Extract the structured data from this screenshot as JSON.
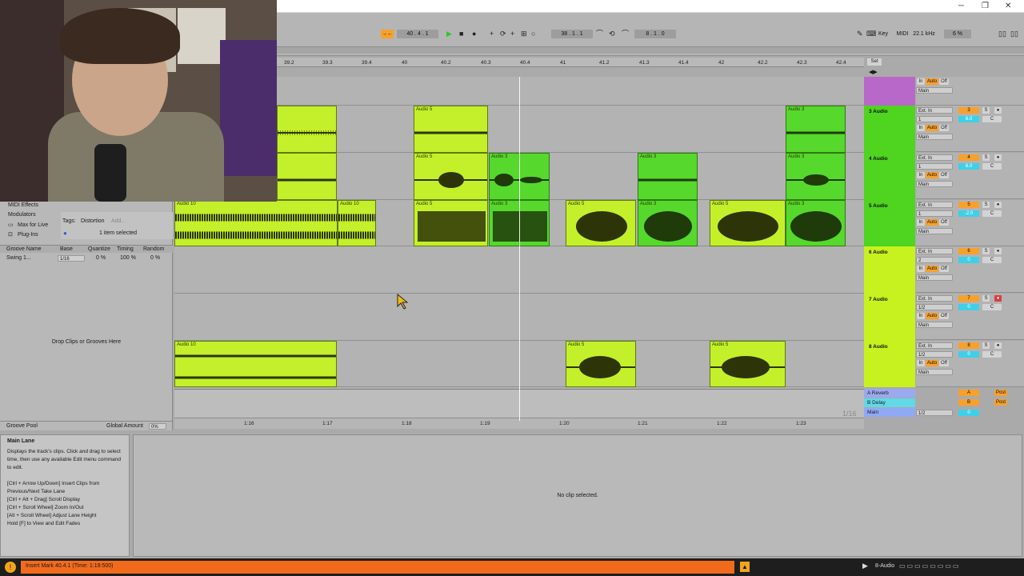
{
  "window": {
    "minimize": "─",
    "restore": "❐",
    "close": "✕"
  },
  "transport": {
    "tempo_nudge": "→←",
    "position": "40 . 4 . 1",
    "loop_start": "38 . 1 . 1",
    "loop_length": "8 . 1 . 0",
    "midi_label": "MIDI",
    "key_label": "Key",
    "sample_rate": "22.1 kHz",
    "cpu": "6 %"
  },
  "ruler": [
    "39.2",
    "39.3",
    "39.4",
    "40",
    "40.2",
    "40.3",
    "40.4",
    "41",
    "41.2",
    "41.3",
    "41.4",
    "42",
    "42.2",
    "42.3",
    "42.4"
  ],
  "ruler_set": "Set",
  "timebar": [
    "1:16",
    "1:17",
    "1:18",
    "1:19",
    "1:20",
    "1:21",
    "1:22",
    "1:23"
  ],
  "grid_label": "1/16",
  "tracks": [
    {
      "name": "3 Audio",
      "color": "#4fd41f",
      "input": "Ext. In",
      "channel": "1",
      "monitor": [
        "In",
        "Auto",
        "Off"
      ],
      "out": "Main",
      "num": "3",
      "vol": "6.0",
      "pan": "C"
    },
    {
      "name": "4 Audio",
      "color": "#4fd41f",
      "input": "Ext. In",
      "channel": "1",
      "monitor": [
        "In",
        "Auto",
        "Off"
      ],
      "out": "Main",
      "num": "4",
      "vol": "6.0",
      "pan": "C"
    },
    {
      "name": "5 Audio",
      "color": "#4fd41f",
      "input": "Ext. In",
      "channel": "1",
      "monitor": [
        "In",
        "Auto",
        "Off"
      ],
      "out": "Main",
      "num": "5",
      "vol": "-2.0",
      "pan": "C"
    },
    {
      "name": "6 Audio",
      "color": "#c7f21f",
      "input": "Ext. In",
      "channel": "2",
      "monitor": [
        "In",
        "Auto",
        "Off"
      ],
      "out": "Main",
      "num": "6",
      "vol": "0",
      "pan": "C"
    },
    {
      "name": "7 Audio",
      "color": "#c7f21f",
      "input": "Ext. In",
      "channel": "1/2",
      "monitor": [
        "In",
        "Auto",
        "Off"
      ],
      "out": "Main",
      "num": "7",
      "vol": "0",
      "pan": "C"
    },
    {
      "name": "8 Audio",
      "color": "#c7f21f",
      "input": "Ext. In",
      "channel": "1/2",
      "monitor": [
        "In",
        "Auto",
        "Off"
      ],
      "out": "Main",
      "num": "8",
      "vol": "0",
      "pan": "C"
    }
  ],
  "top_track": {
    "monitor": [
      "In",
      "Auto",
      "Off"
    ],
    "out": "Main"
  },
  "returns": [
    {
      "name": "A Reverb",
      "letter": "A",
      "post": "Post"
    },
    {
      "name": "B Delay",
      "letter": "B",
      "post": "Post"
    },
    {
      "name": "Main",
      "channel": "1/2",
      "vol": "0"
    }
  ],
  "clips": {
    "audio5": "Audio 5",
    "audio3": "Audio 3",
    "audio10": "Audio 10"
  },
  "browser": {
    "items": [
      "MIDI Effects",
      "Modulators",
      "Max for Live",
      "Plug-Ins"
    ],
    "tags_label": "Tags:",
    "tag": "Distortion",
    "tag_add": "Add...",
    "selected": "1 item selected",
    "groove_headers": [
      "Groove Name",
      "Base",
      "Quantize",
      "Timing",
      "Random"
    ],
    "groove_row": {
      "name": "Swing 1...",
      "base": "1/16",
      "quantize": "0 %",
      "timing": "100 %",
      "random": "0 %"
    },
    "drop_text": "Drop Clips or Grooves Here",
    "groove_pool": "Groove Pool",
    "global_amount": "Global Amount",
    "global_value": "0%"
  },
  "info": {
    "title": "Main Lane",
    "body": "Displays the track's clips. Click and drag to select time, then use any available Edit menu command to edit.",
    "shortcuts": [
      "[Ctrl + Arrow Up/Down] Insert Clips from Previous/Next Take Lane",
      "[Ctrl + Alt + Drag] Scroll Display",
      "[Ctrl + Scroll Wheel] Zoom In/Out",
      "[Alt + Scroll Wheel] Adjust Lane Height",
      "Hold [F] to View and Edit Fades"
    ]
  },
  "detail": "No clip selected.",
  "status": {
    "message": "Insert Mark 40.4.1 (Time: 1:19:500)",
    "track": "8-Audio"
  },
  "colors": {
    "clip_lime": "#c3f02a",
    "clip_green": "#56d82c",
    "accent": "#f7a12c",
    "status": "#f26b1d"
  }
}
